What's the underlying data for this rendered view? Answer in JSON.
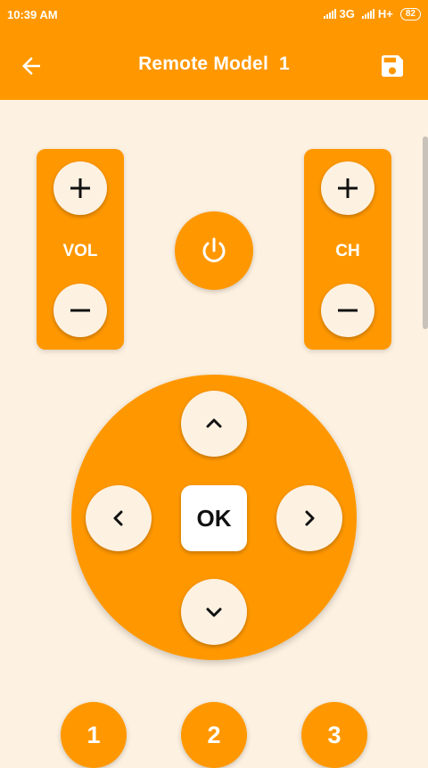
{
  "status_bar": {
    "time": "10:39 AM",
    "network_1": "3G",
    "network_2": "H+",
    "battery": "82"
  },
  "app_bar": {
    "title": "Remote Model  1",
    "back_icon": "arrow-left-icon",
    "save_icon": "floppy-disk-icon"
  },
  "remote": {
    "volume_label": "VOL",
    "channel_label": "CH",
    "ok_label": "OK",
    "number_keys": [
      "1",
      "2",
      "3"
    ]
  },
  "colors": {
    "accent": "#FF9800",
    "background": "#FDF1E1",
    "text_on_accent": "#FFFFFF"
  }
}
